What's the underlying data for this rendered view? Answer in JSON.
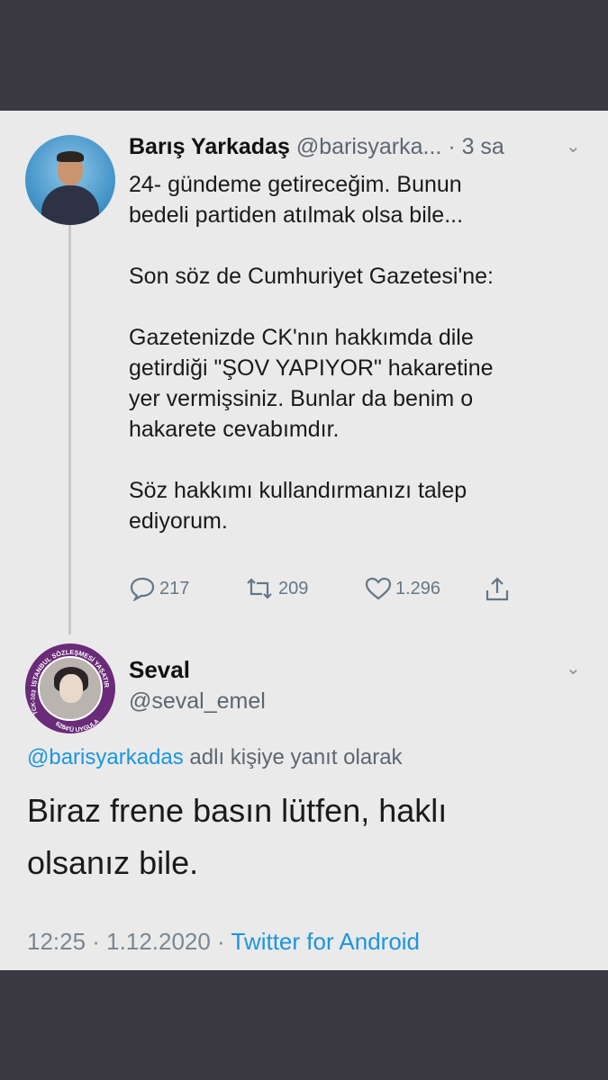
{
  "tweet1": {
    "name": "Barış Yarkadaş",
    "handle": "@barisyarka...",
    "time": "· 3 sa",
    "text": "24- gündeme getireceğim. Bunun\nbedeli partiden atılmak olsa bile...\n\nSon söz de Cumhuriyet Gazetesi'ne:\n\nGazetenizde CK'nın hakkımda dile\ngetirdiği \"ŞOV YAPIYOR\" hakaretine\nyer vermişsiniz. Bunlar da benim o\nhakarete cevabımdır.\n\nSöz hakkımı kullandırmanızı talep\nediyorum.",
    "replies": "217",
    "retweets": "209",
    "likes": "1.296"
  },
  "reply": {
    "name": "Seval",
    "handle": "@seval_emel",
    "reply_to_mention": "@barisyarkadas",
    "reply_to_suffix": " adlı kişiye yanıt olarak",
    "text": "Biraz frene basın lütfen, haklı olsanız bile.",
    "time": "12:25 · 1.12.2020 · ",
    "app": "Twitter for Android",
    "avatar_ring_top": "İSTANBUL SÖZLEŞMESİ YAŞATIR",
    "avatar_ring_left": "TCK-103",
    "avatar_ring_bottom": "6284'Ü UYGULA"
  },
  "colors": {
    "accent": "#1b95e0",
    "panel": "#ebeaea",
    "frame": "#3a3941"
  }
}
